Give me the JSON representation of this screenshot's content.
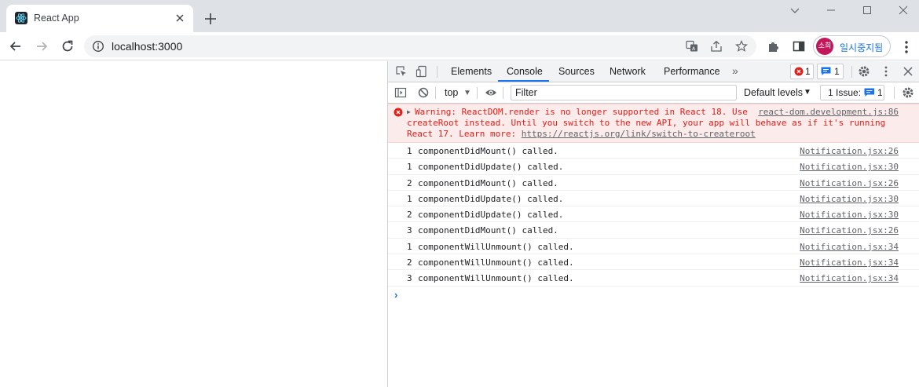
{
  "browser": {
    "tab_title": "React App",
    "url": "localhost:3000",
    "profile_initials": "소희",
    "profile_label": "일시중지됨",
    "icons": [
      "react-favicon",
      "close-icon",
      "plus-icon",
      "minimize-icon",
      "maximize-icon",
      "window-close-icon",
      "back-icon",
      "forward-icon",
      "reload-icon",
      "info-icon",
      "translate-icon",
      "share-icon",
      "star-icon",
      "extensions-icon",
      "sidepanel-icon",
      "kebab-menu-icon"
    ],
    "accent_color": "#1a73e8"
  },
  "devtools": {
    "tabs": [
      "Elements",
      "Console",
      "Sources",
      "Network",
      "Performance"
    ],
    "active_tab": "Console",
    "more_tabs": "»",
    "error_count": "1",
    "message_count": "1",
    "context": "top",
    "filter_placeholder": "Filter",
    "levels": "Default levels",
    "issues_label": "1 Issue:",
    "issues_count": "1",
    "icons": [
      "inspect-icon",
      "device-toolbar-icon",
      "settings-icon",
      "kebab-icon",
      "close-icon",
      "sidebar-toggle-icon",
      "clear-console-icon",
      "eye-icon",
      "error-icon",
      "message-icon"
    ]
  },
  "console": {
    "error": {
      "line1": "Warning: ReactDOM.render is no longer supported in React 18. Use",
      "line2": "createRoot instead. Until you switch to the new API, your app will behave as if it's running",
      "line3_prefix": "React 17. Learn more: ",
      "line3_link": "https://reactjs.org/link/switch-to-createroot",
      "source": "react-dom.development.js:86",
      "color": "#e0201a"
    },
    "logs": [
      {
        "count": "1",
        "text": "componentDidMount() called.",
        "source": "Notification.jsx:26"
      },
      {
        "count": "1",
        "text": "componentDidUpdate() called.",
        "source": "Notification.jsx:30"
      },
      {
        "count": "2",
        "text": "componentDidMount() called.",
        "source": "Notification.jsx:26"
      },
      {
        "count": "1",
        "text": "componentDidUpdate() called.",
        "source": "Notification.jsx:30"
      },
      {
        "count": "2",
        "text": "componentDidUpdate() called.",
        "source": "Notification.jsx:30"
      },
      {
        "count": "3",
        "text": "componentDidMount() called.",
        "source": "Notification.jsx:26"
      },
      {
        "count": "1",
        "text": "componentWillUnmount() called.",
        "source": "Notification.jsx:34"
      },
      {
        "count": "2",
        "text": "componentWillUnmount() called.",
        "source": "Notification.jsx:34"
      },
      {
        "count": "3",
        "text": "componentWillUnmount() called.",
        "source": "Notification.jsx:34"
      }
    ],
    "prompt": "›"
  }
}
